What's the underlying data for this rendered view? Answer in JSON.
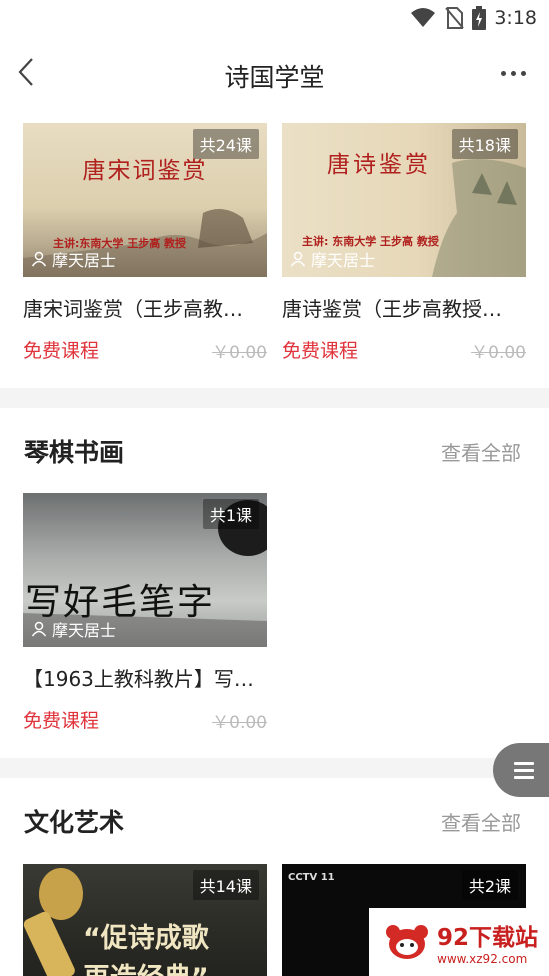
{
  "status_bar": {
    "time": "3:18"
  },
  "header": {
    "title": "诗国学堂"
  },
  "top_courses": [
    {
      "badge": "共24课",
      "author": "摩天居士",
      "title": "唐宋词鉴赏（王步高教…",
      "price_label": "免费课程",
      "original_price": "￥0.00",
      "thumb_title": "唐宋词鉴赏",
      "thumb_caption": "主讲:东南大学 王步高 教授"
    },
    {
      "badge": "共18课",
      "author": "摩天居士",
      "title": "唐诗鉴赏（王步高教授…",
      "price_label": "免费课程",
      "original_price": "￥0.00",
      "thumb_title": "唐诗鉴赏",
      "thumb_caption": "主讲: 东南大学 王步高 教授"
    }
  ],
  "sections": [
    {
      "title": "琴棋书画",
      "view_all": "查看全部",
      "courses": [
        {
          "badge": "共1课",
          "author": "摩天居士",
          "title": "【1963上教科教片】写…",
          "price_label": "免费课程",
          "original_price": "￥0.00",
          "thumb_title": "写好毛笔字"
        }
      ]
    },
    {
      "title": "文化艺术",
      "view_all": "查看全部",
      "courses": [
        {
          "badge": "共14课",
          "thumb_title": "“促诗成歌",
          "thumb_title2": "再造经典”"
        },
        {
          "badge": "共2课",
          "thumb_logo": "CCTV 11"
        }
      ]
    }
  ],
  "watermark": {
    "name": "92下载站",
    "url": "www.xz92.com"
  },
  "colors": {
    "accent_red": "#e0343c",
    "muted": "#999999",
    "divider": "#f4f4f4"
  }
}
